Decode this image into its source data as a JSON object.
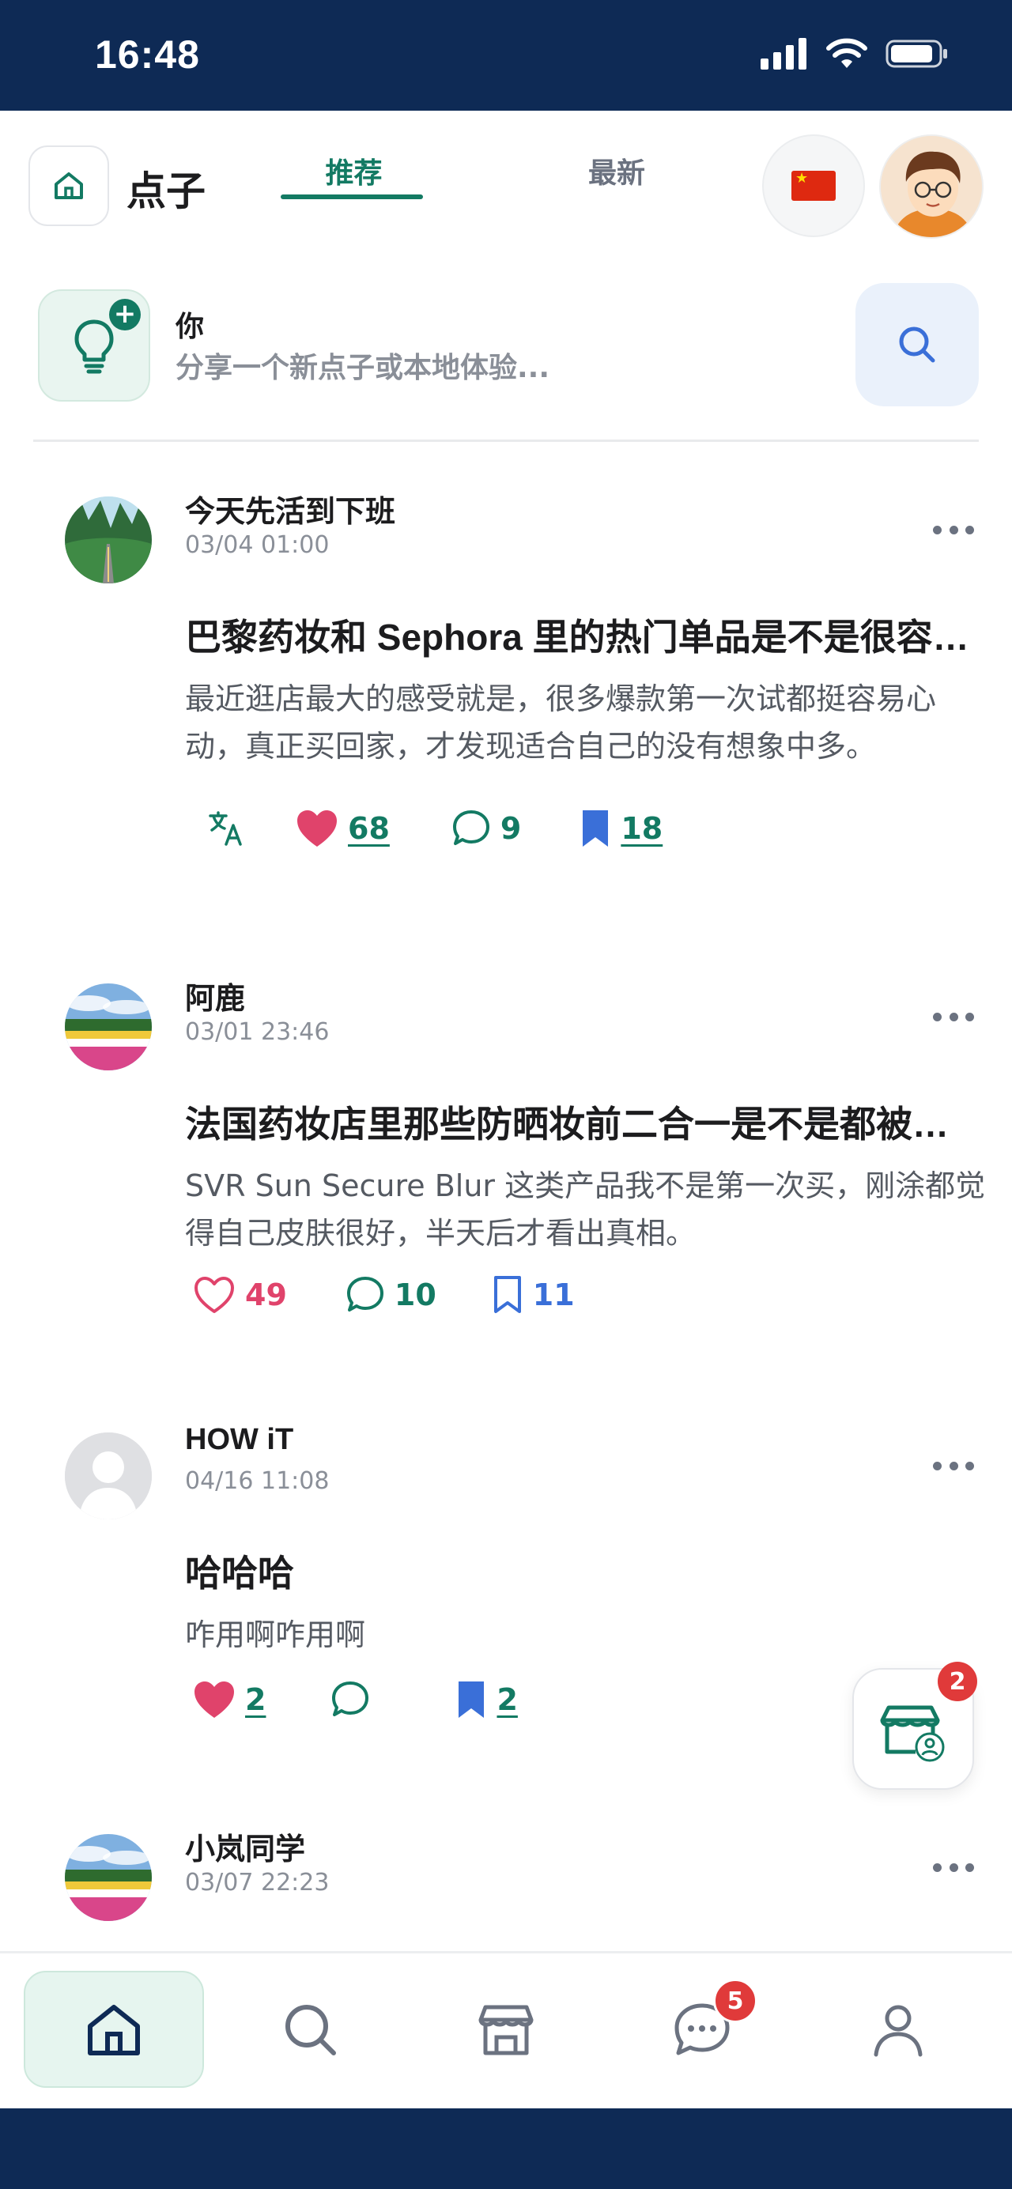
{
  "status_bar": {
    "time": "16:48"
  },
  "header": {
    "title": "点子",
    "tabs": [
      {
        "label": "推荐",
        "active": true
      },
      {
        "label": "最新",
        "active": false
      }
    ]
  },
  "composer": {
    "name": "你",
    "placeholder": "分享一个新点子或本地体验..."
  },
  "posts": [
    {
      "author": "今天先活到下班",
      "time": "03/04 01:00",
      "title": "巴黎药妆和 Sephora 里的热门单品是不是很容易踩雷？",
      "body": "最近逛店最大的感受就是，很多爆款第一次试都挺容易心动，真正买回家，才发现适合自己的没有想象中多。",
      "likes": "68",
      "comments": "9",
      "saves": "18",
      "liked": true,
      "saved": true
    },
    {
      "author": "阿鹿",
      "time": "03/01 23:46",
      "title": "法国药妆店里那些防晒妆前二合一是不是都被高估了？",
      "body": "SVR Sun Secure Blur 这类产品我不是第一次买，刚涂都觉得自己皮肤很好，半天后才看出真相。",
      "likes": "49",
      "comments": "10",
      "saves": "11",
      "liked": false,
      "saved": false
    },
    {
      "author": "HOW iT",
      "time": "04/16 11:08",
      "title": "哈哈哈",
      "body": "咋用啊咋用啊",
      "likes": "2",
      "comments": "",
      "saves": "2",
      "liked": true,
      "saved": true
    },
    {
      "author": "小岚同学",
      "time": "03/07 22:23"
    }
  ],
  "floating_store": {
    "badge": "2"
  },
  "bottom_nav": {
    "items": [
      "home-icon",
      "search-icon",
      "store-icon",
      "chat-icon",
      "profile-icon"
    ],
    "chat_badge": "5"
  },
  "colors": {
    "accent": "#137a63",
    "like": "#e0436b",
    "save": "#3a6fd8",
    "status_bar": "#0e2a55"
  }
}
